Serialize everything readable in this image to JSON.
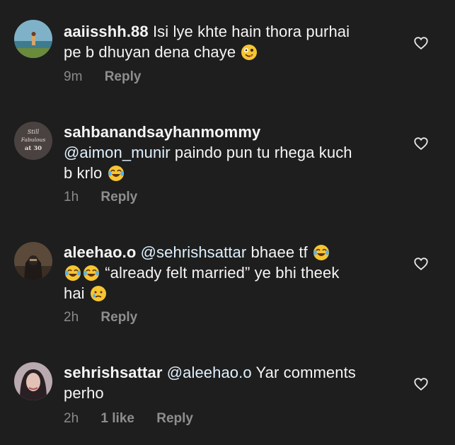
{
  "comments": [
    {
      "username": "aaiisshh.88",
      "mention": "",
      "text_line1": "Isi lye khte hain thora purhai",
      "text_line2": "pe b dhuyan dena chaye",
      "time": "9m",
      "likes": "",
      "reply": "Reply",
      "avatar_icon": "beach-photo-avatar",
      "emoji_after": "zany-face-icon"
    },
    {
      "username": "sahbanandsayhanmommy",
      "mention": "@aimon_munir",
      "text_line1": "paindo pun tu rhega kuch",
      "text_line2": "b krlo",
      "time": "1h",
      "likes": "",
      "reply": "Reply",
      "avatar_icon": "still-fabulous-at-30-avatar",
      "avatar_text_1": "Still",
      "avatar_text_2": "Fabulous",
      "avatar_text_3": "at 30",
      "emoji_after": "tears-of-joy-icon"
    },
    {
      "username": "aleehao.o",
      "mention": "@sehrishsattar",
      "text_line1": "bhaee tf",
      "text_line2": "“already felt married” ye bhi theek",
      "text_line3": "hai",
      "time": "2h",
      "likes": "",
      "reply": "Reply",
      "avatar_icon": "hooded-figure-avatar",
      "emoji_after": "tears-of-joy-icon"
    },
    {
      "username": "sehrishsattar",
      "mention": "@aleehao.o",
      "text_line1": "Yar comments",
      "text_line2": "perho",
      "time": "2h",
      "likes": "1 like",
      "reply": "Reply",
      "avatar_icon": "profile-photo-avatar"
    }
  ],
  "colors": {
    "background": "#1e1e1e",
    "text": "#f5f5f5",
    "meta": "#8a8a8a",
    "emoji": "#f7c531"
  }
}
